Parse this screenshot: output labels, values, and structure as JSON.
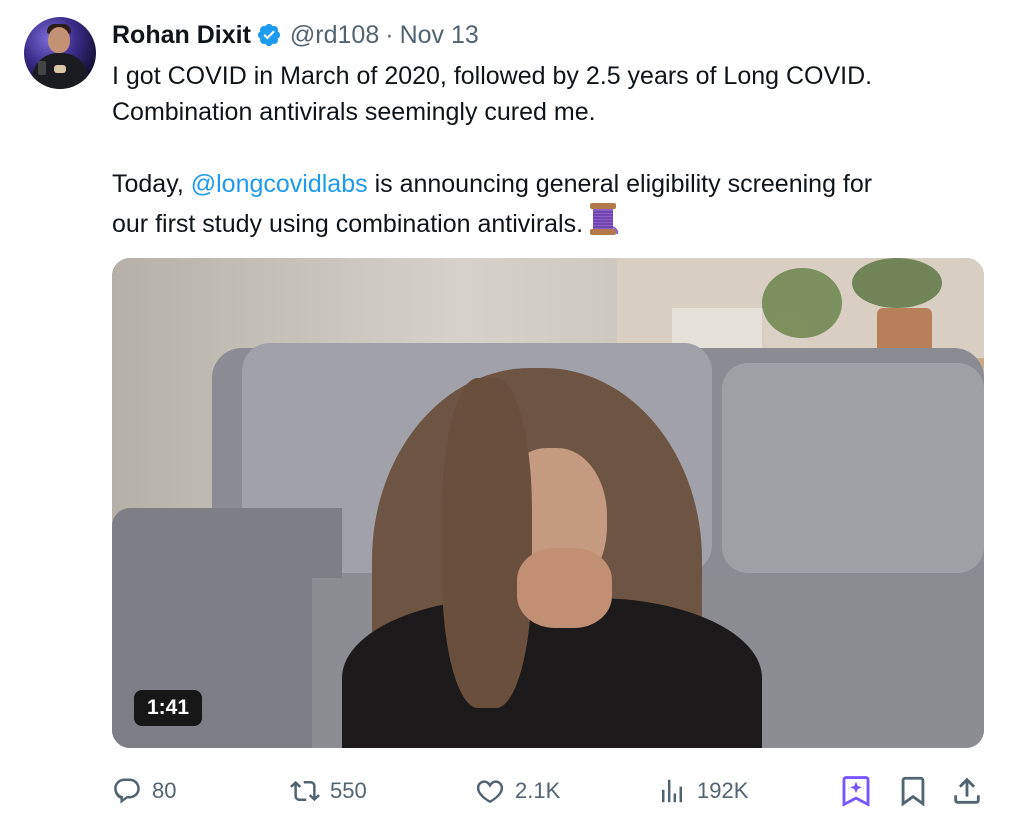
{
  "tweet": {
    "author_name": "Rohan Dixit",
    "handle": "@rd108",
    "separator": "·",
    "date": "Nov 13",
    "line1": "I got COVID in March of 2020, followed by 2.5 years of Long COVID.",
    "line2": "Combination antivirals seemingly cured me.",
    "para2_prefix": "Today, ",
    "mention": "@longcovidlabs",
    "para2_after_mention": " is announcing general eligibility screening for",
    "para2_line2": "our first study using combination antivirals.",
    "emoji": "spool-of-thread"
  },
  "media": {
    "duration": "1:41"
  },
  "actions": {
    "replies": "80",
    "reposts": "550",
    "likes": "2.1K",
    "views": "192K"
  },
  "colors": {
    "text": "#0f1419",
    "secondary": "#536471",
    "link": "#1d9bf0",
    "accent_purple": "#7856ff"
  }
}
